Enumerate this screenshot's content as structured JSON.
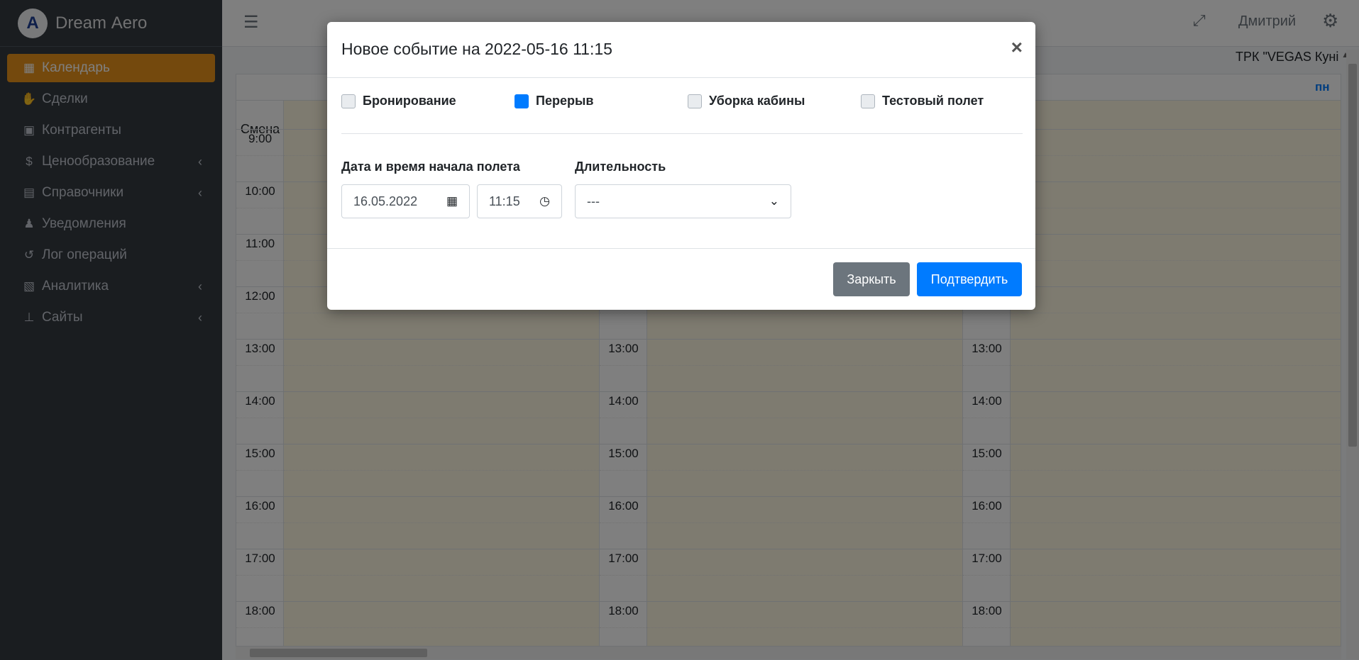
{
  "brand": {
    "logo_letter": "A",
    "name_bold": "Dream",
    "name_light": "Aero"
  },
  "sidebar": {
    "items": [
      {
        "label": "Календарь",
        "icon": "calendar-icon",
        "glyph": "▦",
        "active": true,
        "has_arrow": false
      },
      {
        "label": "Сделки",
        "icon": "handshake-icon",
        "glyph": "✋",
        "active": false,
        "has_arrow": false
      },
      {
        "label": "Контрагенты",
        "icon": "contact-card-icon",
        "glyph": "▣",
        "active": false,
        "has_arrow": false
      },
      {
        "label": "Ценообразование",
        "icon": "dollar-icon",
        "glyph": "$",
        "active": false,
        "has_arrow": true
      },
      {
        "label": "Справочники",
        "icon": "book-icon",
        "glyph": "▤",
        "active": false,
        "has_arrow": true
      },
      {
        "label": "Уведомления",
        "icon": "bell-icon",
        "glyph": "♟",
        "active": false,
        "has_arrow": false
      },
      {
        "label": "Лог операций",
        "icon": "history-icon",
        "glyph": "↺",
        "active": false,
        "has_arrow": false
      },
      {
        "label": "Аналитика",
        "icon": "excel-file-icon",
        "glyph": "▧",
        "active": false,
        "has_arrow": true
      },
      {
        "label": "Сайты",
        "icon": "sitemap-icon",
        "glyph": "⊥",
        "active": false,
        "has_arrow": true
      }
    ],
    "arrow_glyph": "‹"
  },
  "topbar": {
    "menu_glyph": "☰",
    "expand_glyph": "⤢",
    "user_name": "Дмитрий",
    "gear_glyph": "⚙"
  },
  "calendar": {
    "location": "ТРК \"VEGAS Куні",
    "shift_label": "Смена",
    "day_label": "пн",
    "hours": [
      "9:00",
      "10:00",
      "11:00",
      "12:00",
      "13:00",
      "14:00",
      "15:00",
      "16:00",
      "17:00",
      "18:00"
    ]
  },
  "modal": {
    "title": "Новое событие на 2022-05-16 11:15",
    "close_glyph": "×",
    "checkboxes": [
      {
        "label": "Бронирование",
        "checked": false
      },
      {
        "label": "Перерыв",
        "checked": true
      },
      {
        "label": "Уборка кабины",
        "checked": false
      },
      {
        "label": "Тестовый полет",
        "checked": false
      }
    ],
    "date_label": "Дата и время начала полета",
    "duration_label": "Длительность",
    "date_value": "16.05.2022",
    "time_value": "11:15",
    "duration_value": "---",
    "calendar_glyph": "▦",
    "clock_glyph": "◷",
    "chevron_glyph": "⌄",
    "close_button": "Заркыть",
    "confirm_button": "Подтвердить"
  },
  "colors": {
    "sidebar_bg": "#343a40",
    "active_item": "#e8931a",
    "primary": "#007bff",
    "secondary": "#6c757d",
    "event_bg": "#fcf7e1"
  }
}
